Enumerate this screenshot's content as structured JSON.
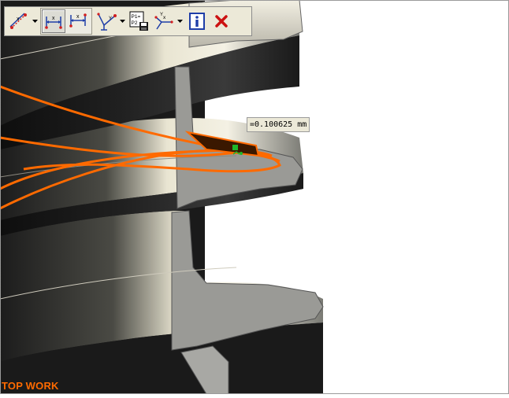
{
  "toolbar": {
    "buttons": [
      {
        "name": "linear-measure",
        "has_dropdown": true
      },
      {
        "name": "horizontal-measure",
        "active": true
      },
      {
        "name": "horizontal-measure-alt"
      },
      {
        "name": "vertical-measure",
        "has_dropdown": true
      },
      {
        "name": "save-points",
        "text": "P1=\nP2"
      },
      {
        "name": "angle-measure",
        "has_dropdown": true
      },
      {
        "name": "info"
      },
      {
        "name": "close"
      }
    ]
  },
  "measurement": {
    "value": "=0.100625 mm"
  },
  "view": {
    "label": "TOP WORK"
  },
  "colors": {
    "accent_orange": "#ff6a00",
    "part_dark": "#2a2a2a",
    "part_light": "#e8e4d6",
    "toolbar_bg": "#ece9d8",
    "close_red": "#cc1111",
    "info_blue": "#1f3ea8"
  }
}
